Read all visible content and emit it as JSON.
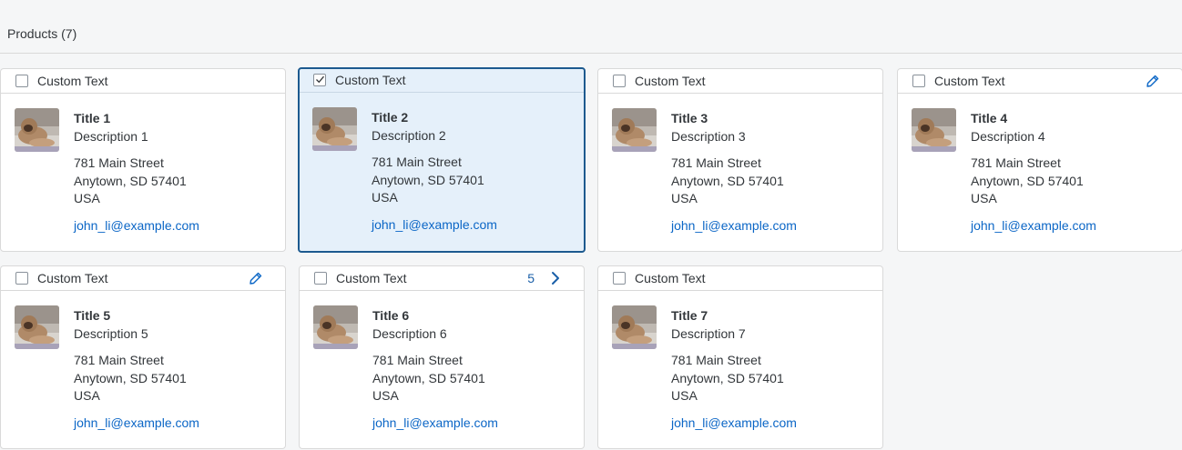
{
  "header": {
    "title": "Products (7)"
  },
  "colors": {
    "link": "#0b66c6",
    "selected_bg": "#e5f0fa",
    "selected_border": "#1d5a8f",
    "text": "#32363a"
  },
  "cards": [
    {
      "header_text": "Custom Text",
      "checked": false,
      "title": "Title 1",
      "description": "Description 1",
      "address_line1": "781 Main Street",
      "address_line2": "Anytown, SD 57401",
      "country": "USA",
      "email": "john_li@example.com"
    },
    {
      "header_text": "Custom Text",
      "checked": true,
      "title": "Title 2",
      "description": "Description 2",
      "address_line1": "781 Main Street",
      "address_line2": "Anytown, SD 57401",
      "country": "USA",
      "email": "john_li@example.com"
    },
    {
      "header_text": "Custom Text",
      "checked": false,
      "title": "Title 3",
      "description": "Description 3",
      "address_line1": "781 Main Street",
      "address_line2": "Anytown, SD 57401",
      "country": "USA",
      "email": "john_li@example.com"
    },
    {
      "header_text": "Custom Text",
      "checked": false,
      "action_icon": "edit-icon",
      "title": "Title 4",
      "description": "Description 4",
      "address_line1": "781 Main Street",
      "address_line2": "Anytown, SD 57401",
      "country": "USA",
      "email": "john_li@example.com"
    },
    {
      "header_text": "Custom Text",
      "checked": false,
      "action_icon": "edit-icon",
      "title": "Title 5",
      "description": "Description 5",
      "address_line1": "781 Main Street",
      "address_line2": "Anytown, SD 57401",
      "country": "USA",
      "email": "john_li@example.com"
    },
    {
      "header_text": "Custom Text",
      "checked": false,
      "counter": "5",
      "action_icon": "chevron-right-icon",
      "title": "Title 6",
      "description": "Description 6",
      "address_line1": "781 Main Street",
      "address_line2": "Anytown, SD 57401",
      "country": "USA",
      "email": "john_li@example.com"
    },
    {
      "header_text": "Custom Text",
      "checked": false,
      "title": "Title 7",
      "description": "Description 7",
      "address_line1": "781 Main Street",
      "address_line2": "Anytown, SD 57401",
      "country": "USA",
      "email": "john_li@example.com"
    }
  ]
}
